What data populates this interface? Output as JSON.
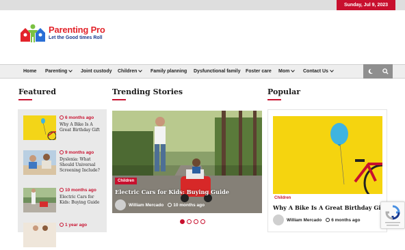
{
  "topbar": {
    "date": "Sunday, Jul 9, 2023"
  },
  "brand": {
    "name": "Parenting Pro",
    "tagline": "Let the Good times Roll"
  },
  "nav": {
    "items": [
      {
        "label": "Home"
      },
      {
        "label": "Parenting"
      },
      {
        "label": "Joint custody"
      },
      {
        "label": "Children"
      },
      {
        "label": "Family planning"
      },
      {
        "label": "Dysfunctional family"
      },
      {
        "label": "Foster care"
      },
      {
        "label": "Mom"
      },
      {
        "label": "Contact Us"
      }
    ],
    "tools": {
      "theme_icon": "moon-icon",
      "search_icon": "search-icon"
    }
  },
  "featured": {
    "title": "Featured",
    "items": [
      {
        "time": "6 months ago",
        "title": "Why A Bike Is A Great Birthday Gift"
      },
      {
        "time": "9 months ago",
        "title": "Dyslexia: What Should Universal Screening Include?"
      },
      {
        "time": "10 months ago",
        "title": "Electric Cars for Kids: Buying Guide"
      },
      {
        "time": "1 year ago",
        "title": ""
      }
    ]
  },
  "trending": {
    "title": "Trending Stories",
    "hero": {
      "tag": "Children",
      "title": "Electric Cars for Kids: Buying Guide",
      "author": "William Mercado",
      "time": "10 months ago"
    },
    "slides_total": 4,
    "slides_active": 1
  },
  "popular": {
    "title": "Popular",
    "card": {
      "tag": "Children",
      "title": "Why A Bike Is A Great Birthday Gift",
      "author": "William Mercado",
      "time": "6 months ago"
    }
  },
  "colors": {
    "accent": "#c8102e",
    "nav_bg": "#eeeeee",
    "tools_bg": "#8f8f8f"
  }
}
